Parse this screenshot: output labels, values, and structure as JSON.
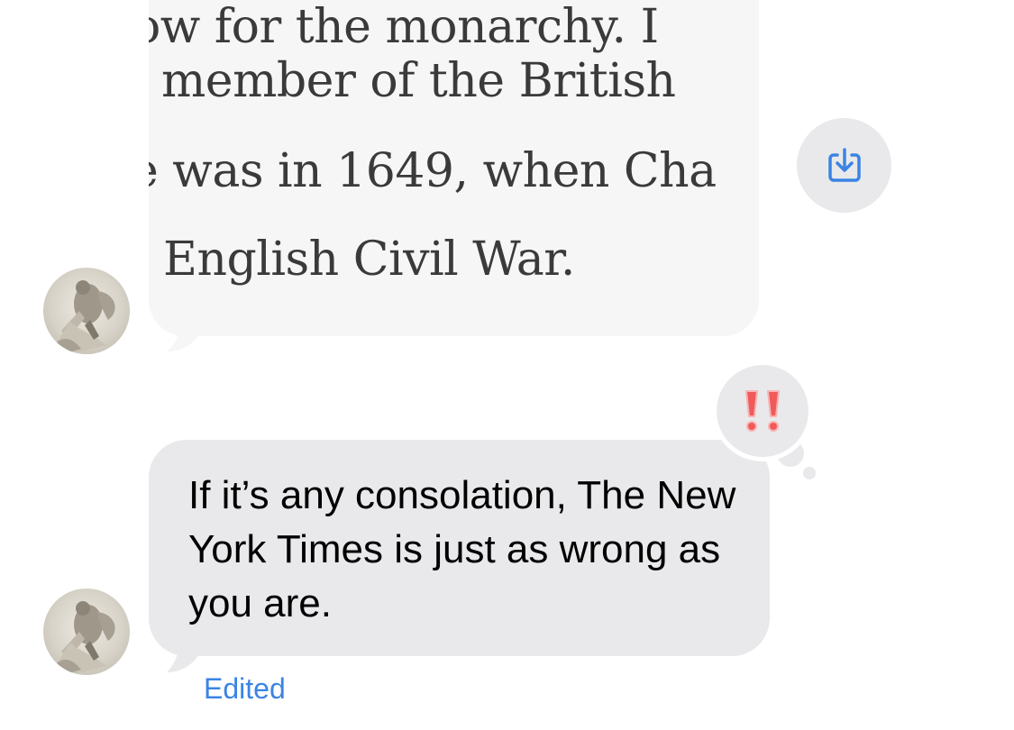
{
  "image_message": {
    "lines": [
      "ow for the monarchy. I",
      "member of the British",
      "e was in 1649, when Cha",
      "English Civil War."
    ]
  },
  "text_message": {
    "text": "If it’s any consolation, The New York Times is just as wrong as you are.",
    "status_label": "Edited"
  },
  "icons": {
    "save": "download-icon",
    "reaction": "double-exclamation-icon",
    "avatar": "contact-avatar"
  },
  "colors": {
    "bubble_gray": "#e9e9eb",
    "link_blue": "#3b84e4",
    "reaction_red": "#f05a5a"
  }
}
